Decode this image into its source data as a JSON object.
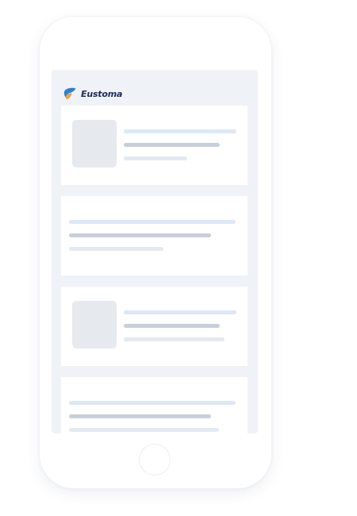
{
  "app": {
    "brand_name": "Eustoma",
    "logo_icon": "eustoma-logo-icon"
  },
  "colors": {
    "brand_navy": "#1f2a5a",
    "logo_blue": "#2f7fd6",
    "logo_orange": "#f2a23a",
    "screen_background": "#eff2f7",
    "placeholder_title": "#dbe8f8",
    "placeholder_subtitle": "#c9cfda",
    "placeholder_meta": "#e4e9f1",
    "placeholder_thumbnail": "#e6eaef"
  },
  "feed": {
    "cards": [
      {
        "kind": "skeleton-with-thumbnail"
      },
      {
        "kind": "skeleton-text-only"
      },
      {
        "kind": "skeleton-with-thumbnail"
      },
      {
        "kind": "skeleton-text-only"
      }
    ]
  }
}
